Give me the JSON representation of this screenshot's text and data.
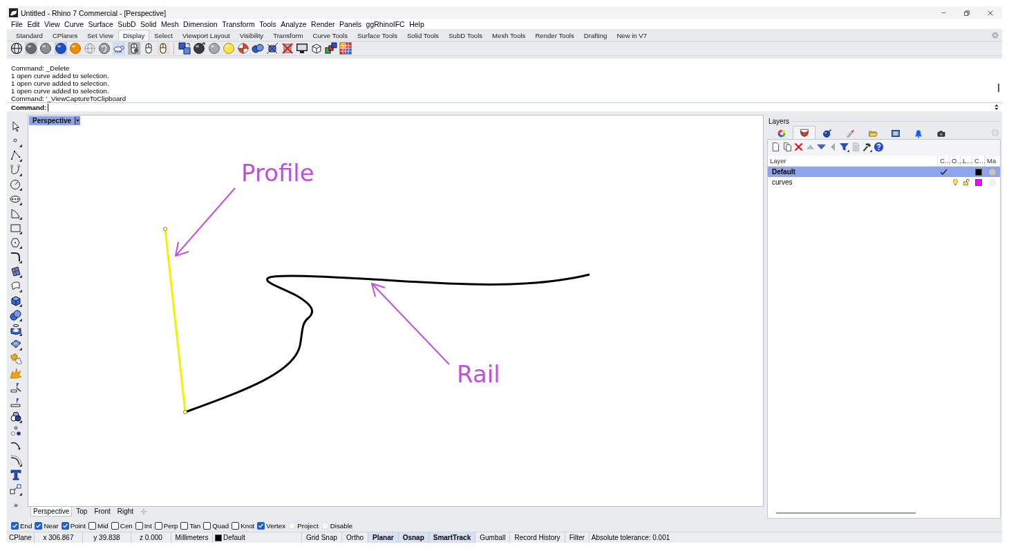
{
  "window": {
    "title": "Untitled - Rhino 7 Commercial - [Perspective]"
  },
  "menu": [
    "File",
    "Edit",
    "View",
    "Curve",
    "Surface",
    "SubD",
    "Solid",
    "Mesh",
    "Dimension",
    "Transform",
    "Tools",
    "Analyze",
    "Render",
    "Panels",
    "ggRhinoIFC",
    "Help"
  ],
  "toolbar_tabs": [
    {
      "label": "Standard",
      "selected": false
    },
    {
      "label": "CPlanes",
      "selected": false
    },
    {
      "label": "Set View",
      "selected": false
    },
    {
      "label": "Display",
      "selected": true
    },
    {
      "label": "Select",
      "selected": false
    },
    {
      "label": "Viewport Layout",
      "selected": false
    },
    {
      "label": "Visibility",
      "selected": false
    },
    {
      "label": "Transform",
      "selected": false
    },
    {
      "label": "Curve Tools",
      "selected": false
    },
    {
      "label": "Surface Tools",
      "selected": false
    },
    {
      "label": "Solid Tools",
      "selected": false
    },
    {
      "label": "SubD Tools",
      "selected": false
    },
    {
      "label": "Mesh Tools",
      "selected": false
    },
    {
      "label": "Render Tools",
      "selected": false
    },
    {
      "label": "Drafting",
      "selected": false
    },
    {
      "label": "New in V7",
      "selected": false
    }
  ],
  "command_history": [
    "Command: _Delete",
    "1 open curve added to selection.",
    "1 open curve added to selection.",
    "1 open curve added to selection.",
    "Command: '_ViewCaptureToClipboard"
  ],
  "command_line": {
    "prompt": "Command:"
  },
  "left_toolbar": {
    "more": "»"
  },
  "viewport": {
    "title": "Perspective",
    "annotations": [
      {
        "text": "Profile"
      },
      {
        "text": "Rail"
      }
    ]
  },
  "viewport_tabs": [
    {
      "label": "Perspective",
      "selected": true
    },
    {
      "label": "Top",
      "selected": false
    },
    {
      "label": "Front",
      "selected": false
    },
    {
      "label": "Right",
      "selected": false
    }
  ],
  "layers_panel": {
    "title": "Layers",
    "tabs": [
      {
        "selected": false
      },
      {
        "selected": true
      },
      {
        "selected": false
      },
      {
        "selected": false
      },
      {
        "selected": false
      },
      {
        "selected": false
      },
      {
        "selected": false
      },
      {
        "selected": false
      }
    ],
    "columns": [
      "Layer",
      "C…",
      "O…",
      "L…",
      "C…",
      "Ma"
    ],
    "rows": [
      {
        "name": "Default",
        "selected": true,
        "current": true,
        "color": "#000000"
      },
      {
        "name": "curves",
        "selected": false,
        "current": false,
        "color": "#ff00ff"
      }
    ]
  },
  "osnaps": [
    {
      "label": "End",
      "kind": "check",
      "checked": true
    },
    {
      "label": "Near",
      "kind": "check",
      "checked": true
    },
    {
      "label": "Point",
      "kind": "check",
      "checked": true
    },
    {
      "label": "Mid",
      "kind": "check",
      "checked": false
    },
    {
      "label": "Cen",
      "kind": "check",
      "checked": false
    },
    {
      "label": "Int",
      "kind": "check",
      "checked": false
    },
    {
      "label": "Perp",
      "kind": "check",
      "checked": false
    },
    {
      "label": "Tan",
      "kind": "check",
      "checked": false
    },
    {
      "label": "Quad",
      "kind": "check",
      "checked": false
    },
    {
      "label": "Knot",
      "kind": "check",
      "checked": false
    },
    {
      "label": "Vertex",
      "kind": "check",
      "checked": true
    },
    {
      "label": "Project",
      "kind": "toggle",
      "checked": false
    },
    {
      "label": "Disable",
      "kind": "toggle",
      "checked": false
    }
  ],
  "status_bar": {
    "cplane": "CPlane",
    "x": "x 306.867",
    "y": "y 39.838",
    "z": "z 0.000",
    "units": "Millimeters",
    "layer": {
      "name": "Default",
      "color": "#000000"
    },
    "toggles": [
      {
        "label": "Grid Snap",
        "on": false
      },
      {
        "label": "Ortho",
        "on": false
      },
      {
        "label": "Planar",
        "on": true
      },
      {
        "label": "Osnap",
        "on": true
      },
      {
        "label": "SmartTrack",
        "on": true
      },
      {
        "label": "Gumball",
        "on": false
      },
      {
        "label": "Record History",
        "on": false
      },
      {
        "label": "Filter",
        "on": false
      }
    ],
    "tolerance": "Absolute tolerance: 0.001"
  }
}
